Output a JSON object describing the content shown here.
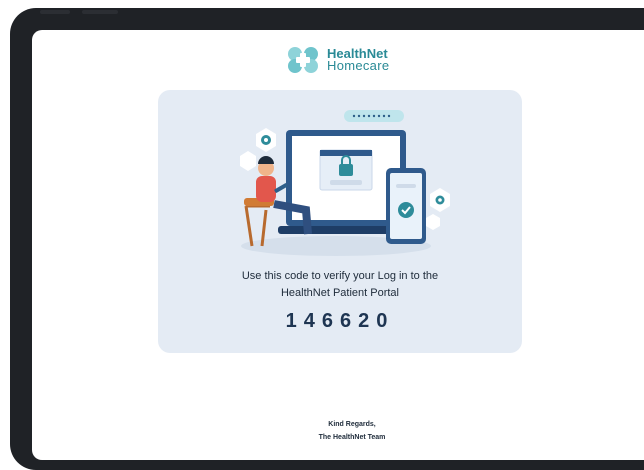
{
  "brand": {
    "name_line1": "HealthNet",
    "name_line2": "Homecare"
  },
  "email": {
    "message_line1": "Use this code to verify your Log in to the",
    "message_line2": "HealthNet Patient Portal",
    "verification_code": "146620",
    "signoff_line1": "Kind Regards,",
    "signoff_line2": "The HealthNet Team"
  },
  "colors": {
    "brand_teal": "#2a8a96",
    "card_background": "#e4ebf4",
    "code_text": "#1e3552",
    "frame": "#1f2226"
  },
  "icons": [
    "healthnet-logo-icon",
    "laptop-lock-illustration",
    "phone-check-icon",
    "gear-icon"
  ]
}
